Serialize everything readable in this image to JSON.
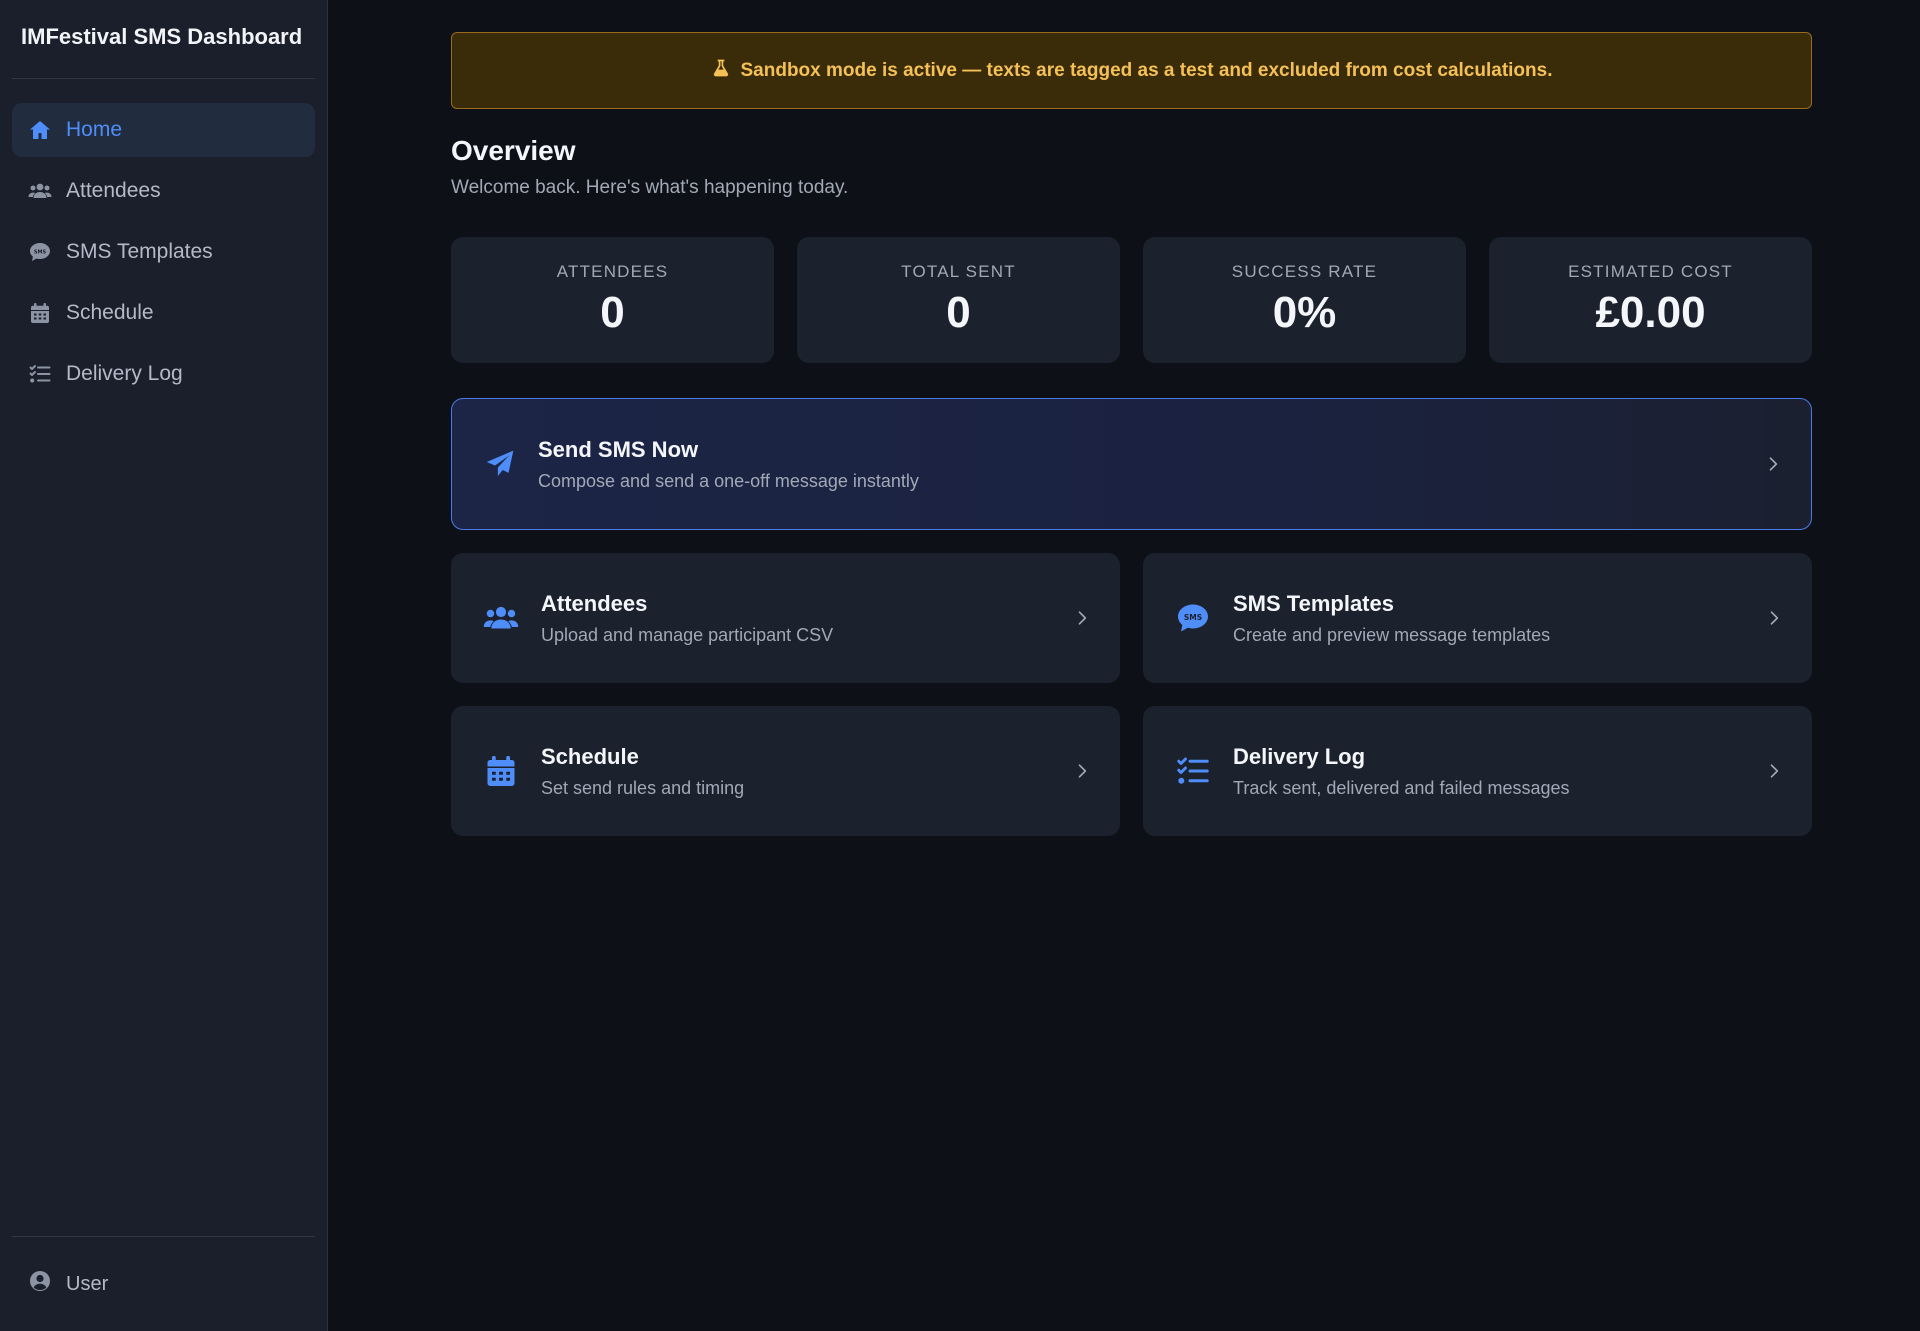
{
  "app": {
    "title": "IMFestival SMS Dashboard"
  },
  "sidebar": {
    "items": [
      {
        "label": "Home",
        "icon": "home-icon",
        "active": true
      },
      {
        "label": "Attendees",
        "icon": "users-icon"
      },
      {
        "label": "SMS Templates",
        "icon": "sms-bubble-icon"
      },
      {
        "label": "Schedule",
        "icon": "calendar-icon"
      },
      {
        "label": "Delivery Log",
        "icon": "list-check-icon"
      }
    ],
    "footer_user": "User"
  },
  "banner": {
    "text": "Sandbox mode is active — texts are tagged as a test and excluded from cost calculations.",
    "icon": "flask-icon"
  },
  "overview": {
    "title": "Overview",
    "subtitle": "Welcome back. Here's what's happening today."
  },
  "stats": [
    {
      "label": "ATTENDEES",
      "value": "0"
    },
    {
      "label": "TOTAL SENT",
      "value": "0"
    },
    {
      "label": "SUCCESS RATE",
      "value": "0%"
    },
    {
      "label": "ESTIMATED COST",
      "value": "£0.00"
    }
  ],
  "hero": {
    "title": "Send SMS Now",
    "desc": "Compose and send a one-off message instantly",
    "icon": "paper-plane-icon"
  },
  "cards": [
    {
      "title": "Attendees",
      "desc": "Upload and manage participant CSV",
      "icon": "users-icon"
    },
    {
      "title": "SMS Templates",
      "desc": "Create and preview message templates",
      "icon": "sms-bubble-icon"
    },
    {
      "title": "Schedule",
      "desc": "Set send rules and timing",
      "icon": "calendar-icon"
    },
    {
      "title": "Delivery Log",
      "desc": "Track sent, delivered and failed messages",
      "icon": "list-check-icon"
    }
  ],
  "colors": {
    "accent": "#4f8df8",
    "banner_text": "#f5c156",
    "banner_bg": "#3a2b09",
    "background": "#0d1117",
    "card": "#1b212d"
  }
}
